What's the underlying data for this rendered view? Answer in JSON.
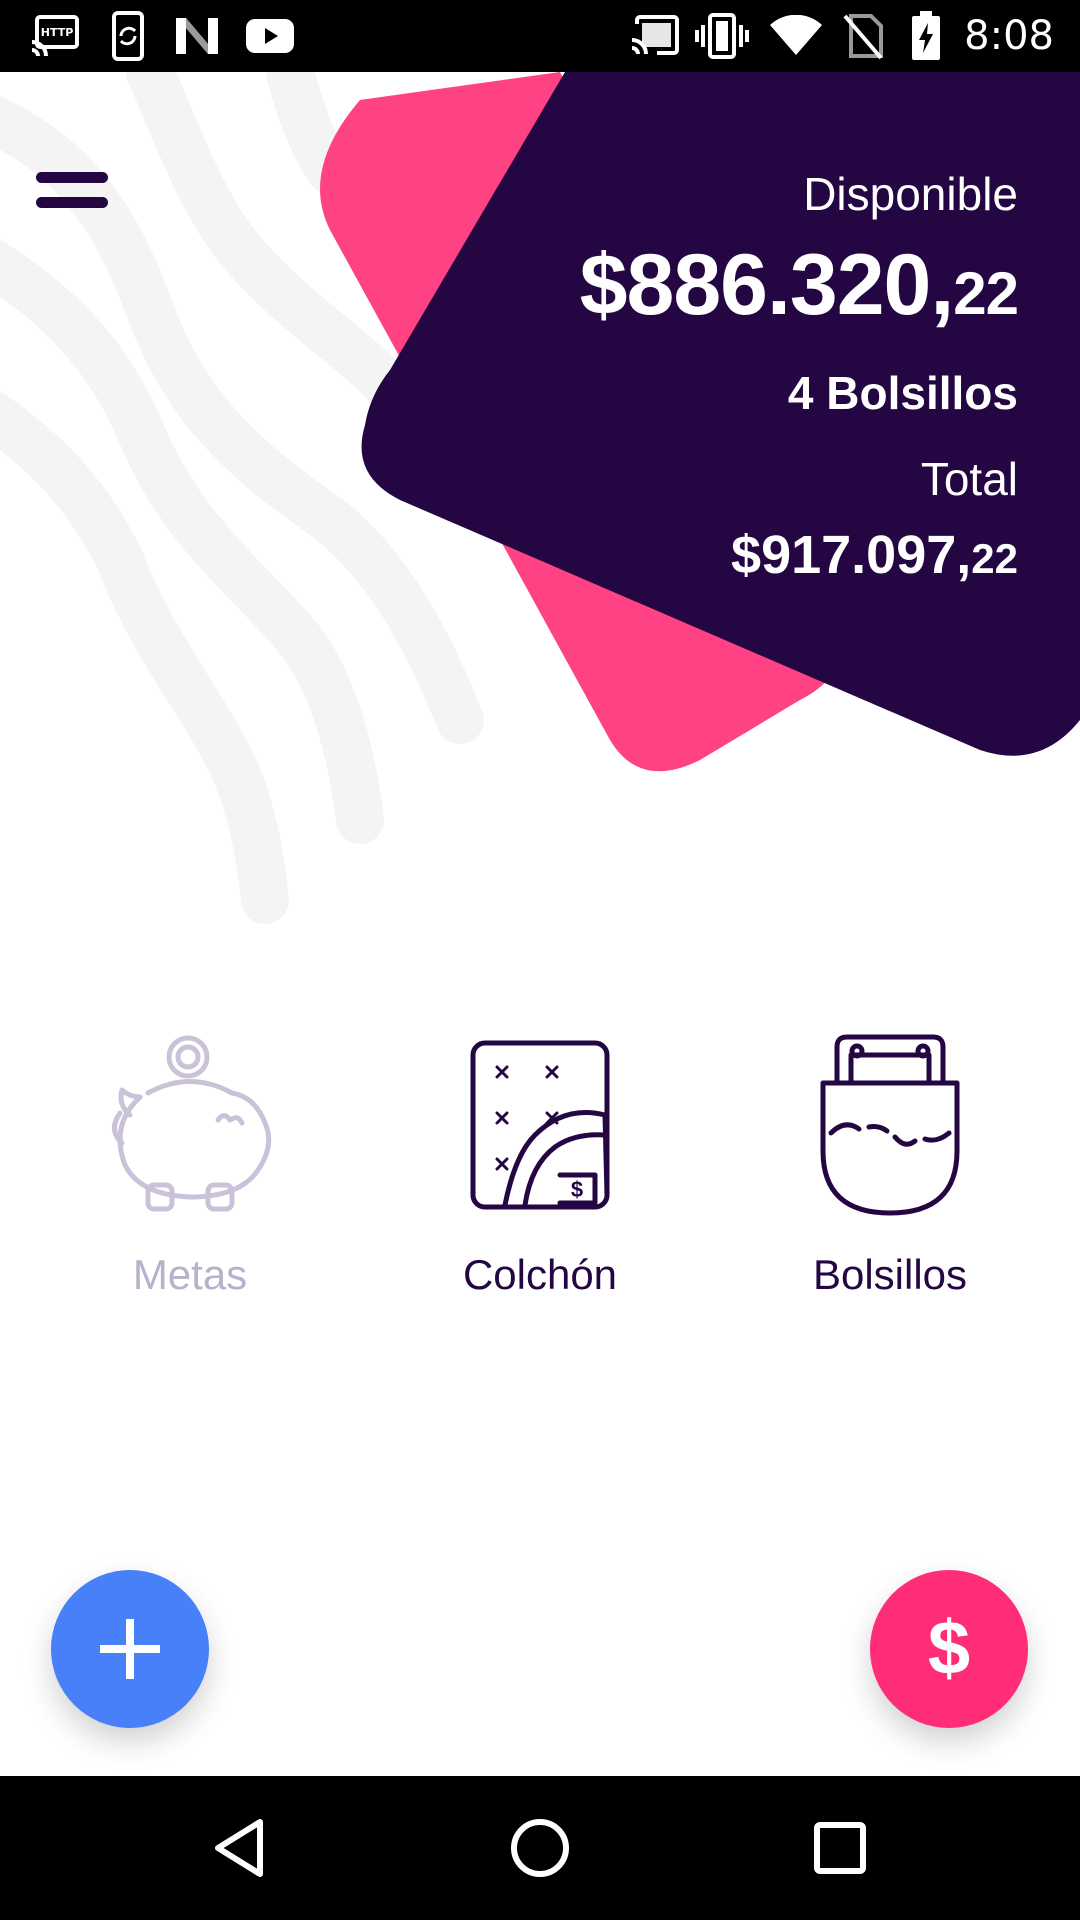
{
  "status_bar": {
    "time": "8:08",
    "left_icons": [
      "cast-http-icon",
      "screen-rotation-icon",
      "n-logo-icon",
      "youtube-icon"
    ],
    "right_icons": [
      "cast-icon",
      "vibrate-icon",
      "wifi-icon",
      "no-sim-icon",
      "battery-charging-icon"
    ]
  },
  "header": {
    "menu_icon": "hamburger-menu-icon"
  },
  "balance": {
    "available_label": "Disponible",
    "available_main": "$886.320,",
    "available_cents": "22",
    "pockets_count": "4 Bolsillos",
    "total_label": "Total",
    "total_main": "$917.097,",
    "total_cents": "22"
  },
  "features": [
    {
      "label": "Metas",
      "icon": "piggy-bank-icon",
      "enabled": false
    },
    {
      "label": "Colchón",
      "icon": "mattress-icon",
      "enabled": true
    },
    {
      "label": "Bolsillos",
      "icon": "pocket-icon",
      "enabled": true
    }
  ],
  "fabs": {
    "add_icon": "plus-icon",
    "pay_symbol": "$"
  },
  "colors": {
    "brand_dark": "#240643",
    "brand_pink": "#ff4283",
    "fab_blue": "#4780f8",
    "fab_pink": "#ff2d78",
    "disabled": "#b9b0cc"
  },
  "nav_bar": [
    "back-icon",
    "home-icon",
    "recents-icon"
  ]
}
